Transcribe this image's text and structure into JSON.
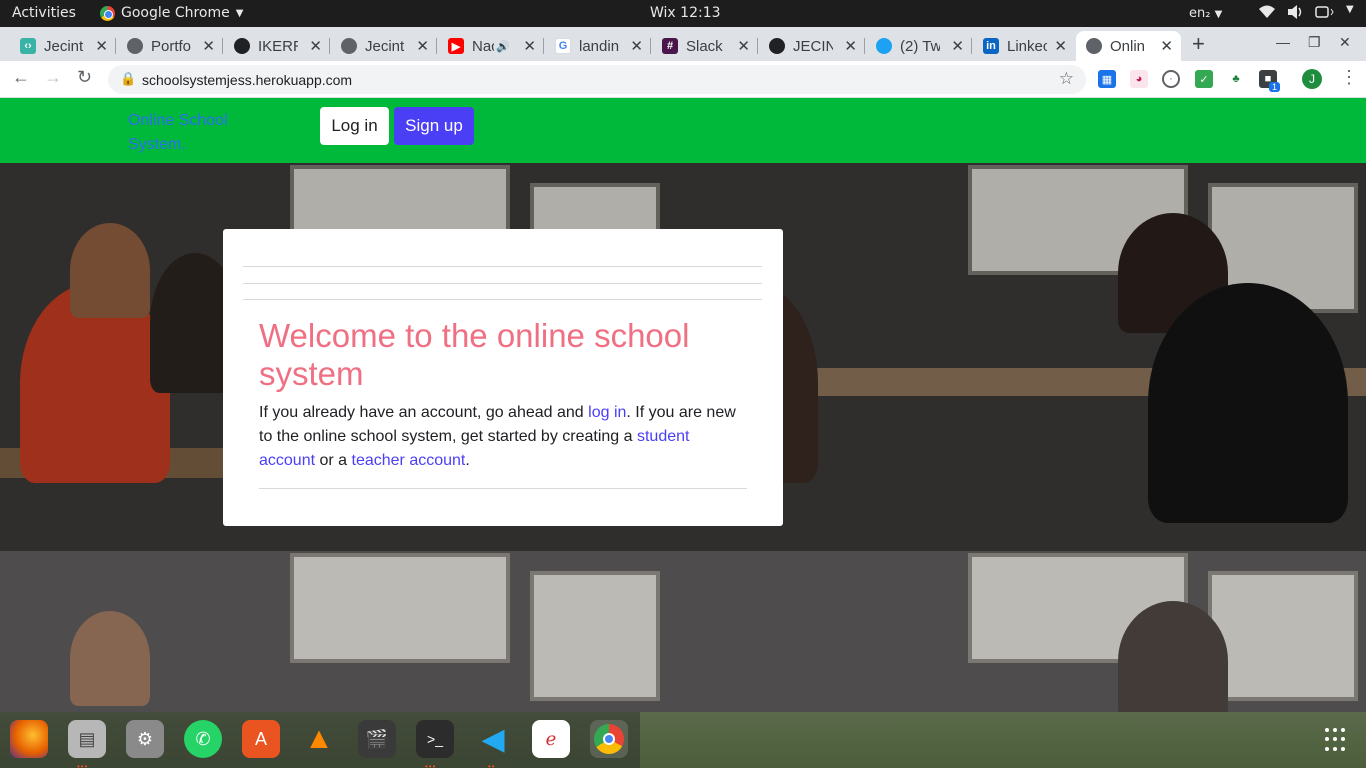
{
  "system_bar": {
    "activities": "Activities",
    "app_name": "Google Chrome",
    "clock": "Wix 12:13",
    "language": "en₂"
  },
  "browser": {
    "tabs": [
      {
        "label": "Jecint",
        "icon": "code-icon"
      },
      {
        "label": "Portfo",
        "icon": "globe-icon"
      },
      {
        "label": "IKERRI",
        "icon": "github-icon"
      },
      {
        "label": "Jecint",
        "icon": "globe-icon"
      },
      {
        "label": "Nac",
        "icon": "youtube-icon"
      },
      {
        "label": "landin",
        "icon": "google-icon"
      },
      {
        "label": "Slack |",
        "icon": "slack-icon"
      },
      {
        "label": "JECIN",
        "icon": "github-icon"
      },
      {
        "label": "(2) Tw",
        "icon": "twitter-icon"
      },
      {
        "label": "Linkec",
        "icon": "linkedin-icon"
      },
      {
        "label": "Onlin",
        "icon": "globe-icon",
        "active": true
      }
    ],
    "url": "schoolsystemjess.herokuapp.com",
    "profile_initial": "J",
    "extension_badge": "1"
  },
  "site": {
    "brand": "Online School System.",
    "login_button": "Log in",
    "signup_button": "Sign up",
    "colors": {
      "navbar": "#00b93a",
      "brand_text": "#2d6ff0",
      "signup_bg": "#4b3ff5",
      "heading": "#f07083",
      "link": "#4b3ff5"
    }
  },
  "card": {
    "heading": "Welcome to the online school system",
    "text_1": "If you already have an account, go ahead and ",
    "link_login": "log in",
    "text_2": ". If you are new to the online school system, get started by creating a ",
    "link_student": "student account",
    "text_3": " or a ",
    "link_teacher": "teacher account",
    "text_4": "."
  },
  "dock": {
    "apps": [
      "firefox-icon",
      "files-icon",
      "settings-icon",
      "whatsapp-icon",
      "software-center-icon",
      "vlc-icon",
      "video-editor-icon",
      "terminal-icon",
      "vscode-icon",
      "document-viewer-icon",
      "chrome-icon"
    ]
  }
}
